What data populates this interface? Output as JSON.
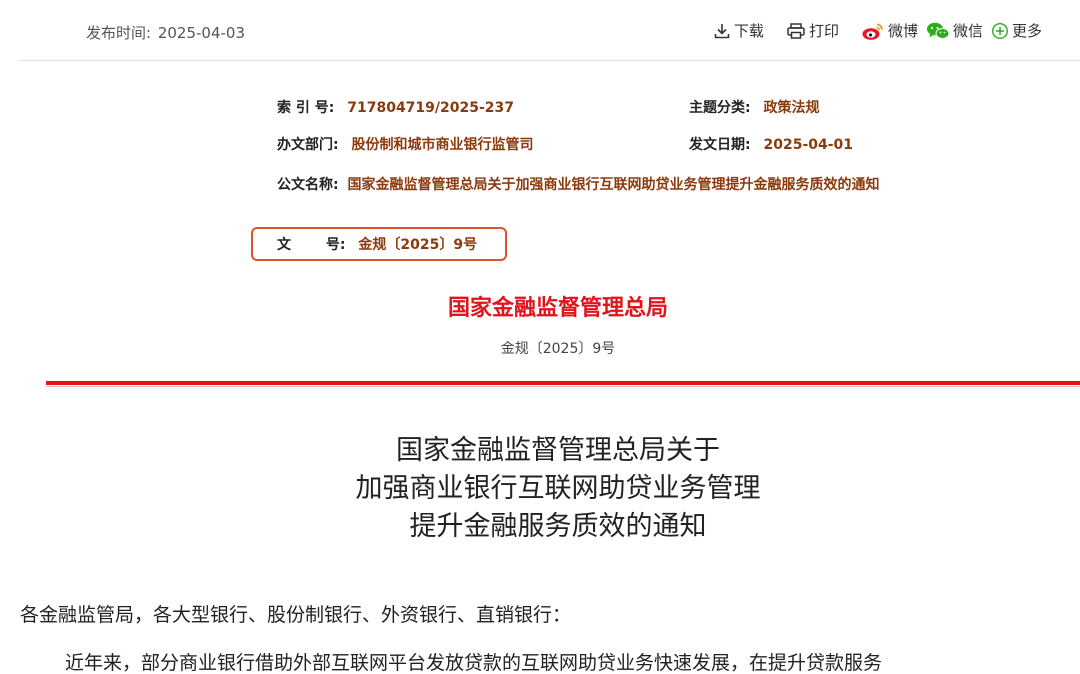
{
  "topbar": {
    "publish_label": "发布时间:",
    "publish_date": "2025-04-03",
    "download": "下载",
    "print": "打印",
    "weibo": "微博",
    "wechat": "微信",
    "more": "更多"
  },
  "meta": {
    "index_label": "索 引 号:",
    "index_value": "717804719/2025-237",
    "topic_label": "主题分类:",
    "topic_value": "政策法规",
    "dept_label": "办文部门:",
    "dept_value": "股份制和城市商业银行监管司",
    "issue_date_label": "发文日期:",
    "issue_date_value": "2025-04-01",
    "docname_label": "公文名称:",
    "docname_value": "国家金融监督管理总局关于加强商业银行互联网助贷业务管理提升金融服务质效的通知",
    "docnum_label_1": "文",
    "docnum_label_2": "号:",
    "docnum_value": "金规〔2025〕9号"
  },
  "header": {
    "issuer": "国家金融监督管理总局",
    "doc_number": "金规〔2025〕9号"
  },
  "title": {
    "line1": "国家金融监督管理总局关于",
    "line2": "加强商业银行互联网助贷业务管理",
    "line3": "提升金融服务质效的通知"
  },
  "body": {
    "salutation": "各金融监管局，各大型银行、股份制银行、外资银行、直销银行：",
    "para1": "近年来，部分商业银行借助外部互联网平台发放贷款的互联网助贷业务快速发展，在提升贷款服务"
  },
  "colors": {
    "accent_red": "#e1141c",
    "meta_value": "#8b3a0e",
    "highlight_box": "#e0522b"
  }
}
